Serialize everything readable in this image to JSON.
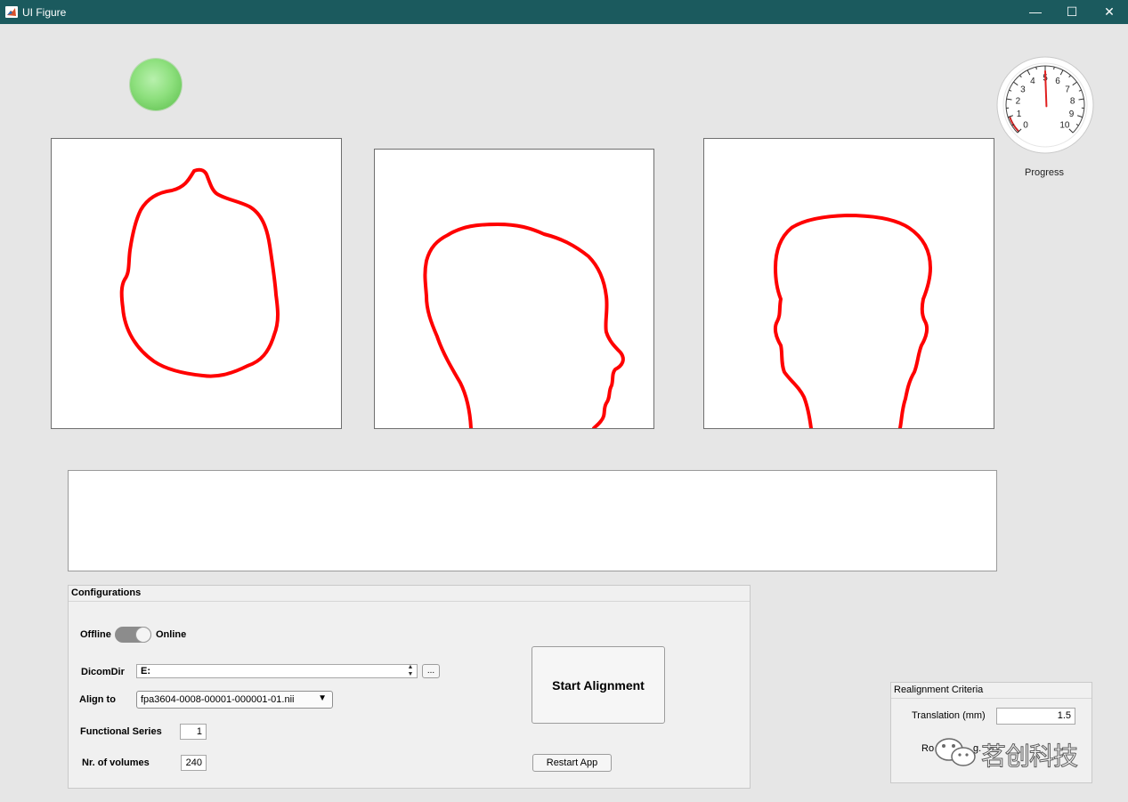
{
  "window": {
    "title": "UI Figure",
    "minimize_glyph": "—",
    "maximize_glyph": "☐",
    "close_glyph": "✕"
  },
  "status_lamp": {
    "color": "#7ed86f",
    "state": "on"
  },
  "gauge": {
    "label": "Progress",
    "min": 0,
    "max": 10,
    "ticks": [
      "0",
      "1",
      "2",
      "3",
      "4",
      "5",
      "6",
      "7",
      "8",
      "9",
      "10"
    ],
    "value": 5,
    "needle_color": "#e02020",
    "low_range_color": "#cc2222"
  },
  "views": [
    {
      "name": "axial",
      "outline_color": "#ff0000"
    },
    {
      "name": "sagittal",
      "outline_color": "#ff0000"
    },
    {
      "name": "coronal",
      "outline_color": "#ff0000"
    }
  ],
  "log_text": "",
  "config": {
    "title": "Configurations",
    "switch": {
      "left_label": "Offline",
      "right_label": "Online",
      "state": "Online"
    },
    "dicom_dir": {
      "label": "DicomDir",
      "value": "E:",
      "browse_label": "..."
    },
    "align_to": {
      "label": "Align to",
      "value": "fpa3604-0008-00001-000001-01.nii"
    },
    "functional_series": {
      "label": "Functional Series",
      "value": "1"
    },
    "nr_volumes": {
      "label": "Nr. of volumes",
      "value": "240"
    },
    "start_button": "Start Alignment",
    "restart_button": "Restart App"
  },
  "realignment": {
    "title": "Realignment Criteria",
    "translation_label": "Translation (mm)",
    "translation_value": "1.5",
    "rotation_label": "Ro",
    "rotation_label_tail": "g."
  },
  "watermark": {
    "text": "茗创科技",
    "icon": "wechat-icon"
  }
}
